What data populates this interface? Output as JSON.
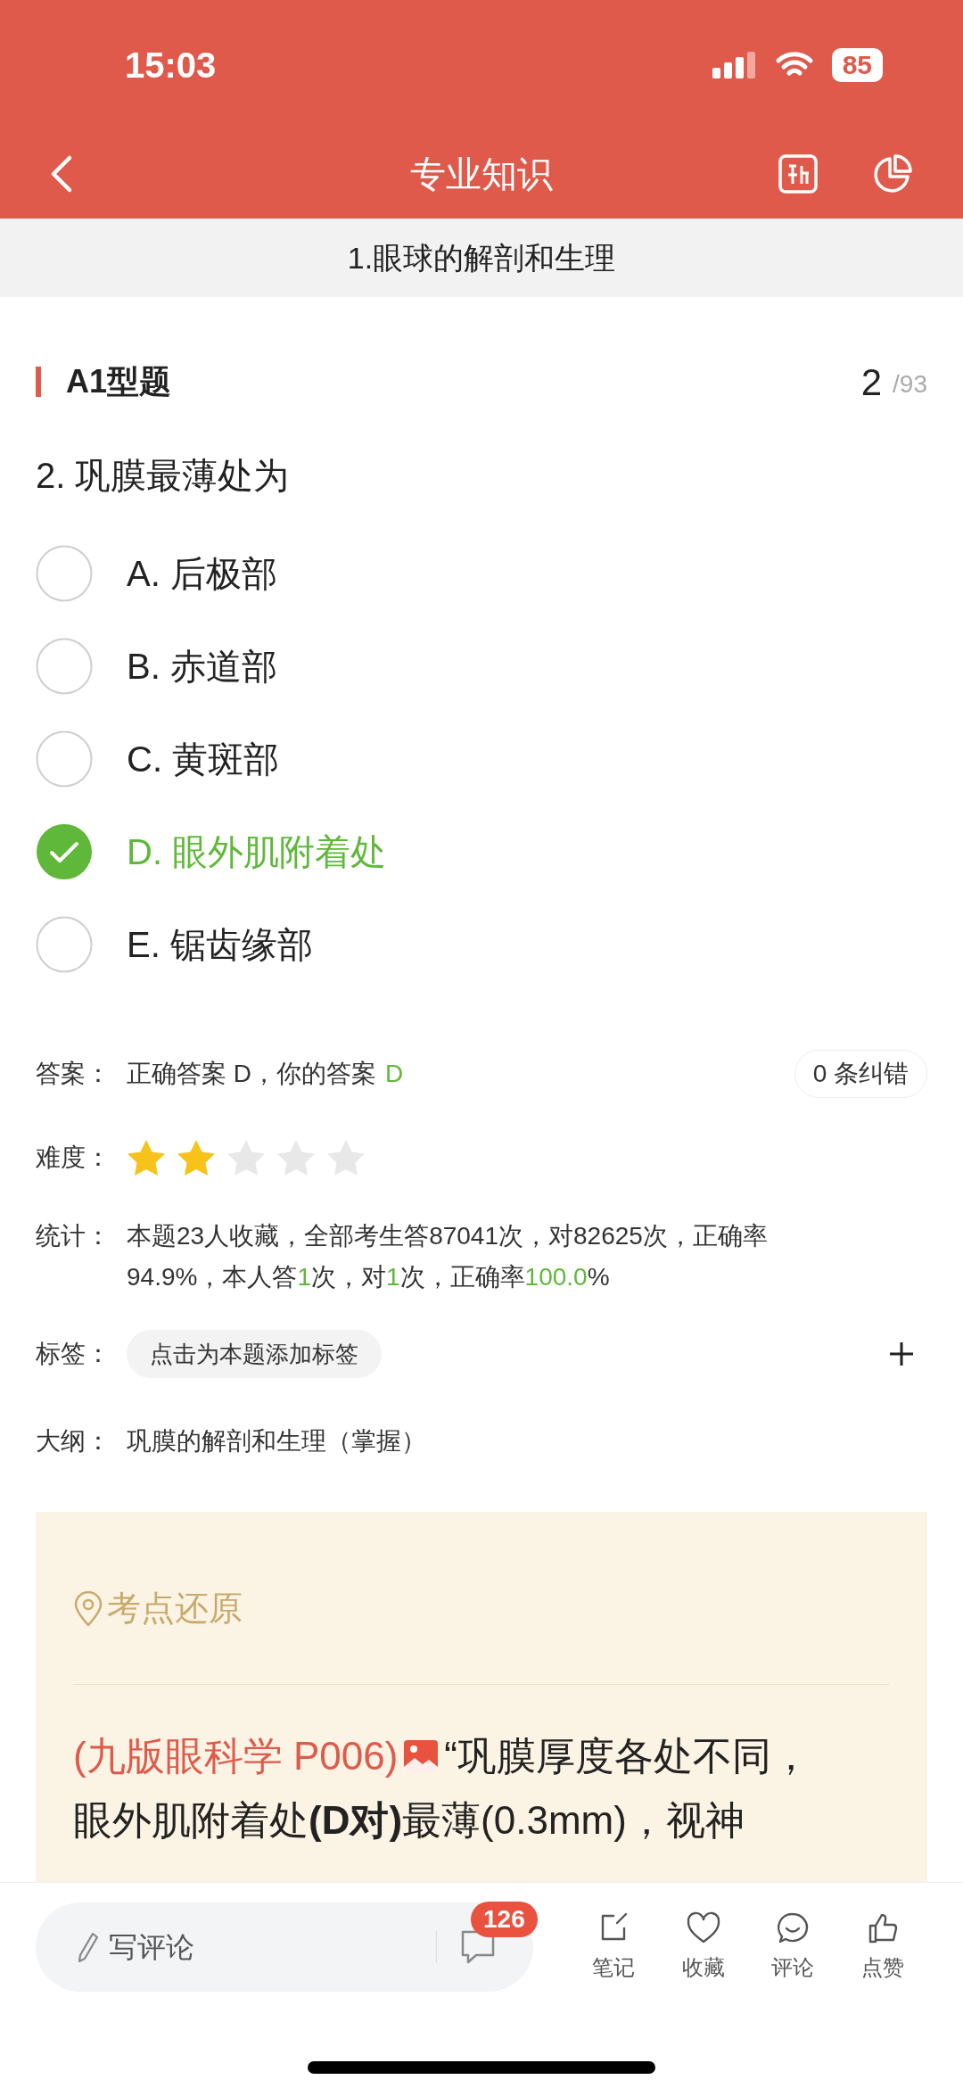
{
  "status_bar": {
    "time": "15:03",
    "battery": "85"
  },
  "nav": {
    "title": "专业知识"
  },
  "subtitle": "1.眼球的解剖和生理",
  "section": {
    "label": "A1型题",
    "current": "2",
    "total": "/93"
  },
  "question": "2. 巩膜最薄处为",
  "options": [
    {
      "label": "A. 后极部",
      "selected": false
    },
    {
      "label": "B. 赤道部",
      "selected": false
    },
    {
      "label": "C. 黄斑部",
      "selected": false
    },
    {
      "label": "D. 眼外肌附着处",
      "selected": true
    },
    {
      "label": "E. 锯齿缘部",
      "selected": false
    }
  ],
  "answer": {
    "label": "答案：",
    "text": "正确答案 D，你的答案",
    "yours": "D",
    "corrections": "0 条纠错"
  },
  "difficulty": {
    "label": "难度：",
    "stars": 2
  },
  "stats": {
    "label": "统计：",
    "segments": [
      {
        "text": "本题23人收藏，全部考生答87041次，对82625次，正确率94.9%，本人答",
        "highlight": false
      },
      {
        "text": "1",
        "highlight": true
      },
      {
        "text": "次，对",
        "highlight": false
      },
      {
        "text": "1",
        "highlight": true
      },
      {
        "text": "次，正确率",
        "highlight": false
      },
      {
        "text": "100.0",
        "highlight": true
      },
      {
        "text": "%",
        "highlight": false
      }
    ]
  },
  "tags": {
    "label": "标签：",
    "add_tag": "点击为本题添加标签"
  },
  "outline": {
    "label": "大纲：",
    "text": "巩膜的解剖和生理（掌握）"
  },
  "explanation": {
    "title": "考点还原",
    "source": "(九版眼科学 P006)",
    "text": "“巩膜厚度各处不同，眼外肌附着处**(D对)**最薄(0.3mm)，视神"
  },
  "bottom_bar": {
    "comment_placeholder": "写评论",
    "comment_count": "126",
    "actions": [
      {
        "label": "笔记",
        "kind": "note"
      },
      {
        "label": "收藏",
        "kind": "favorite"
      },
      {
        "label": "评论",
        "kind": "comment"
      },
      {
        "label": "点赞",
        "kind": "like"
      }
    ]
  }
}
